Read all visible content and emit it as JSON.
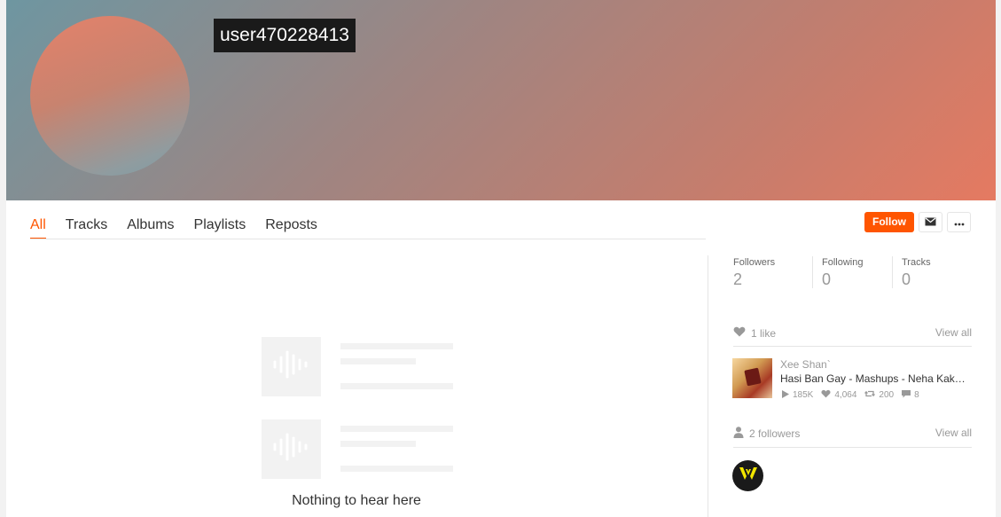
{
  "profile": {
    "username": "user470228413"
  },
  "tabs": [
    {
      "label": "All"
    },
    {
      "label": "Tracks"
    },
    {
      "label": "Albums"
    },
    {
      "label": "Playlists"
    },
    {
      "label": "Reposts"
    }
  ],
  "actions": {
    "follow_label": "Follow"
  },
  "stats": {
    "followers_label": "Followers",
    "followers_value": "2",
    "following_label": "Following",
    "following_value": "0",
    "tracks_label": "Tracks",
    "tracks_value": "0"
  },
  "likes_section": {
    "label": "1 like",
    "view_all": "View all",
    "item": {
      "artist": "Xee Shan`",
      "title": "Hasi Ban Gay - Mashups - Neha Kakkar",
      "plays": "185K",
      "likes": "4,064",
      "reposts": "200",
      "comments": "8"
    }
  },
  "followers_section": {
    "label": "2 followers",
    "view_all": "View all"
  },
  "empty_state": {
    "message": "Nothing to hear here"
  },
  "colors": {
    "accent": "#ff5500"
  }
}
